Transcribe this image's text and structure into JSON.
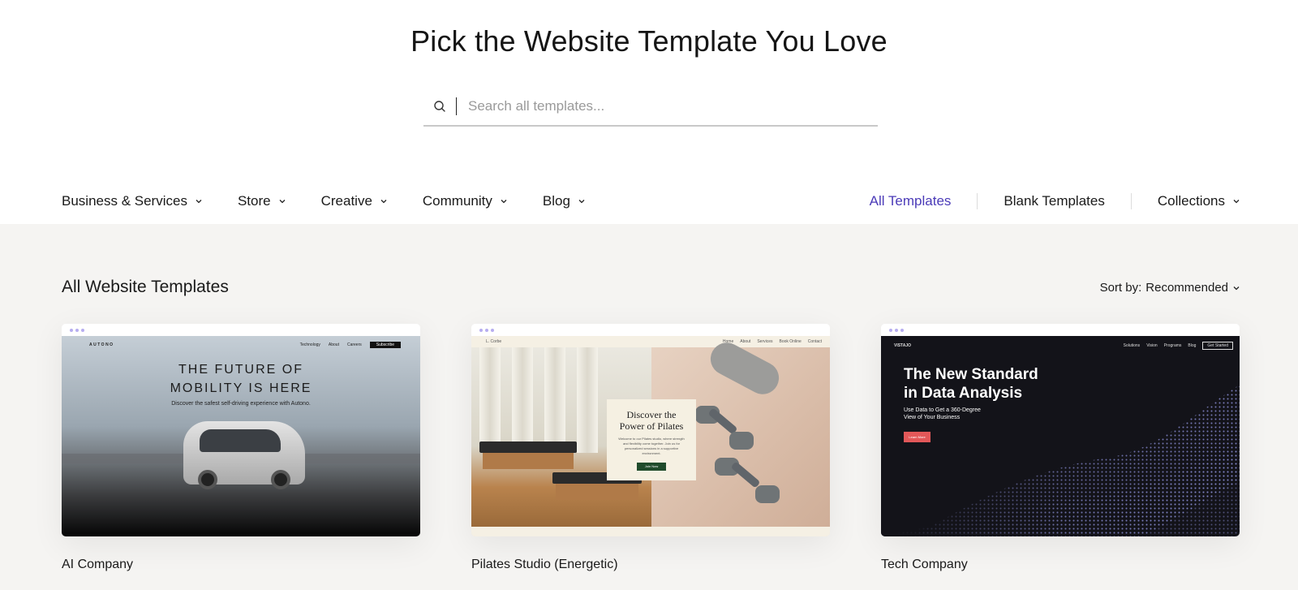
{
  "header": {
    "title": "Pick the Website Template You Love",
    "search_placeholder": "Search all templates..."
  },
  "nav": {
    "categories": [
      {
        "label": "Business & Services"
      },
      {
        "label": "Store"
      },
      {
        "label": "Creative"
      },
      {
        "label": "Community"
      },
      {
        "label": "Blog"
      }
    ],
    "right_links": {
      "all_templates": "All Templates",
      "blank_templates": "Blank Templates",
      "collections": "Collections"
    }
  },
  "main": {
    "section_title": "All Website Templates",
    "sort_label": "Sort by:",
    "sort_value": "Recommended"
  },
  "cards": [
    {
      "name": "AI Company",
      "preview": {
        "logo": "AUTONO",
        "nav_items": [
          "Technology",
          "About",
          "Careers"
        ],
        "nav_button": "Subscribe",
        "heading_line1": "THE FUTURE OF",
        "heading_line2": "MOBILITY IS HERE",
        "subtext": "Discover the safest self-driving experience with Autono."
      }
    },
    {
      "name": "Pilates Studio (Energetic)",
      "preview": {
        "logo": "L. Corbe",
        "nav_items": [
          "Home",
          "About",
          "Services",
          "Book Online",
          "Contact"
        ],
        "heading_line1": "Discover the",
        "heading_line2": "Power of Pilates",
        "subtext": "Welcome to our Pilates studio, where strength and flexibility come together. Join us for personalized sessions in a supportive environment.",
        "button": "Join Now"
      }
    },
    {
      "name": "Tech Company",
      "preview": {
        "logo": "VISTAJO",
        "nav_items": [
          "Solutions",
          "Vision",
          "Programs",
          "Blog"
        ],
        "nav_button": "Get Started",
        "heading_line1": "The New Standard",
        "heading_line2": "in Data Analysis",
        "subtext_line1": "Use Data to Get a 360-Degree",
        "subtext_line2": "View of Your Business",
        "button": "Learn More"
      }
    }
  ],
  "colors": {
    "accent": "#4b3bb8",
    "body_bg": "#f5f4f2",
    "card_dots": "#b7aef0"
  }
}
